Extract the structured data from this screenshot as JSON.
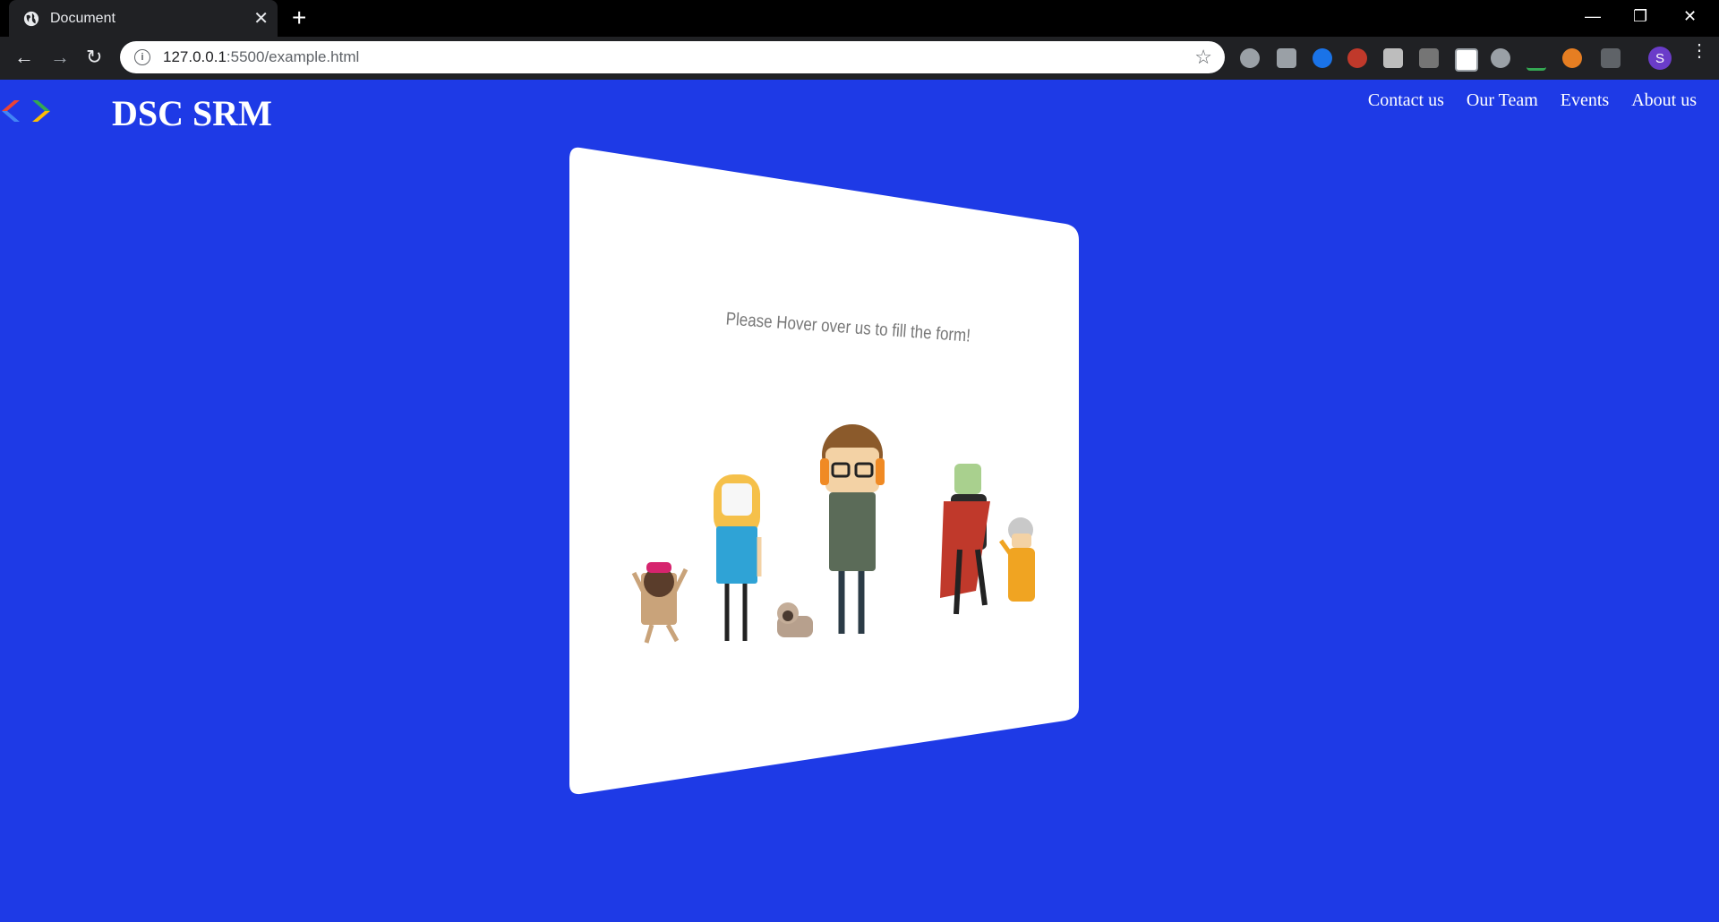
{
  "browser": {
    "tab_title": "Document",
    "url_host": "127.0.0.1",
    "url_path": ":5500/example.html",
    "avatar_letter": "S"
  },
  "page": {
    "brand": "DSC SRM",
    "nav": [
      "Contact us",
      "Our Team",
      "Events",
      "About us"
    ],
    "card_text": "Please Hover over us to fill the form!"
  },
  "colors": {
    "background": "#1e3ae6",
    "card": "#ffffff"
  }
}
